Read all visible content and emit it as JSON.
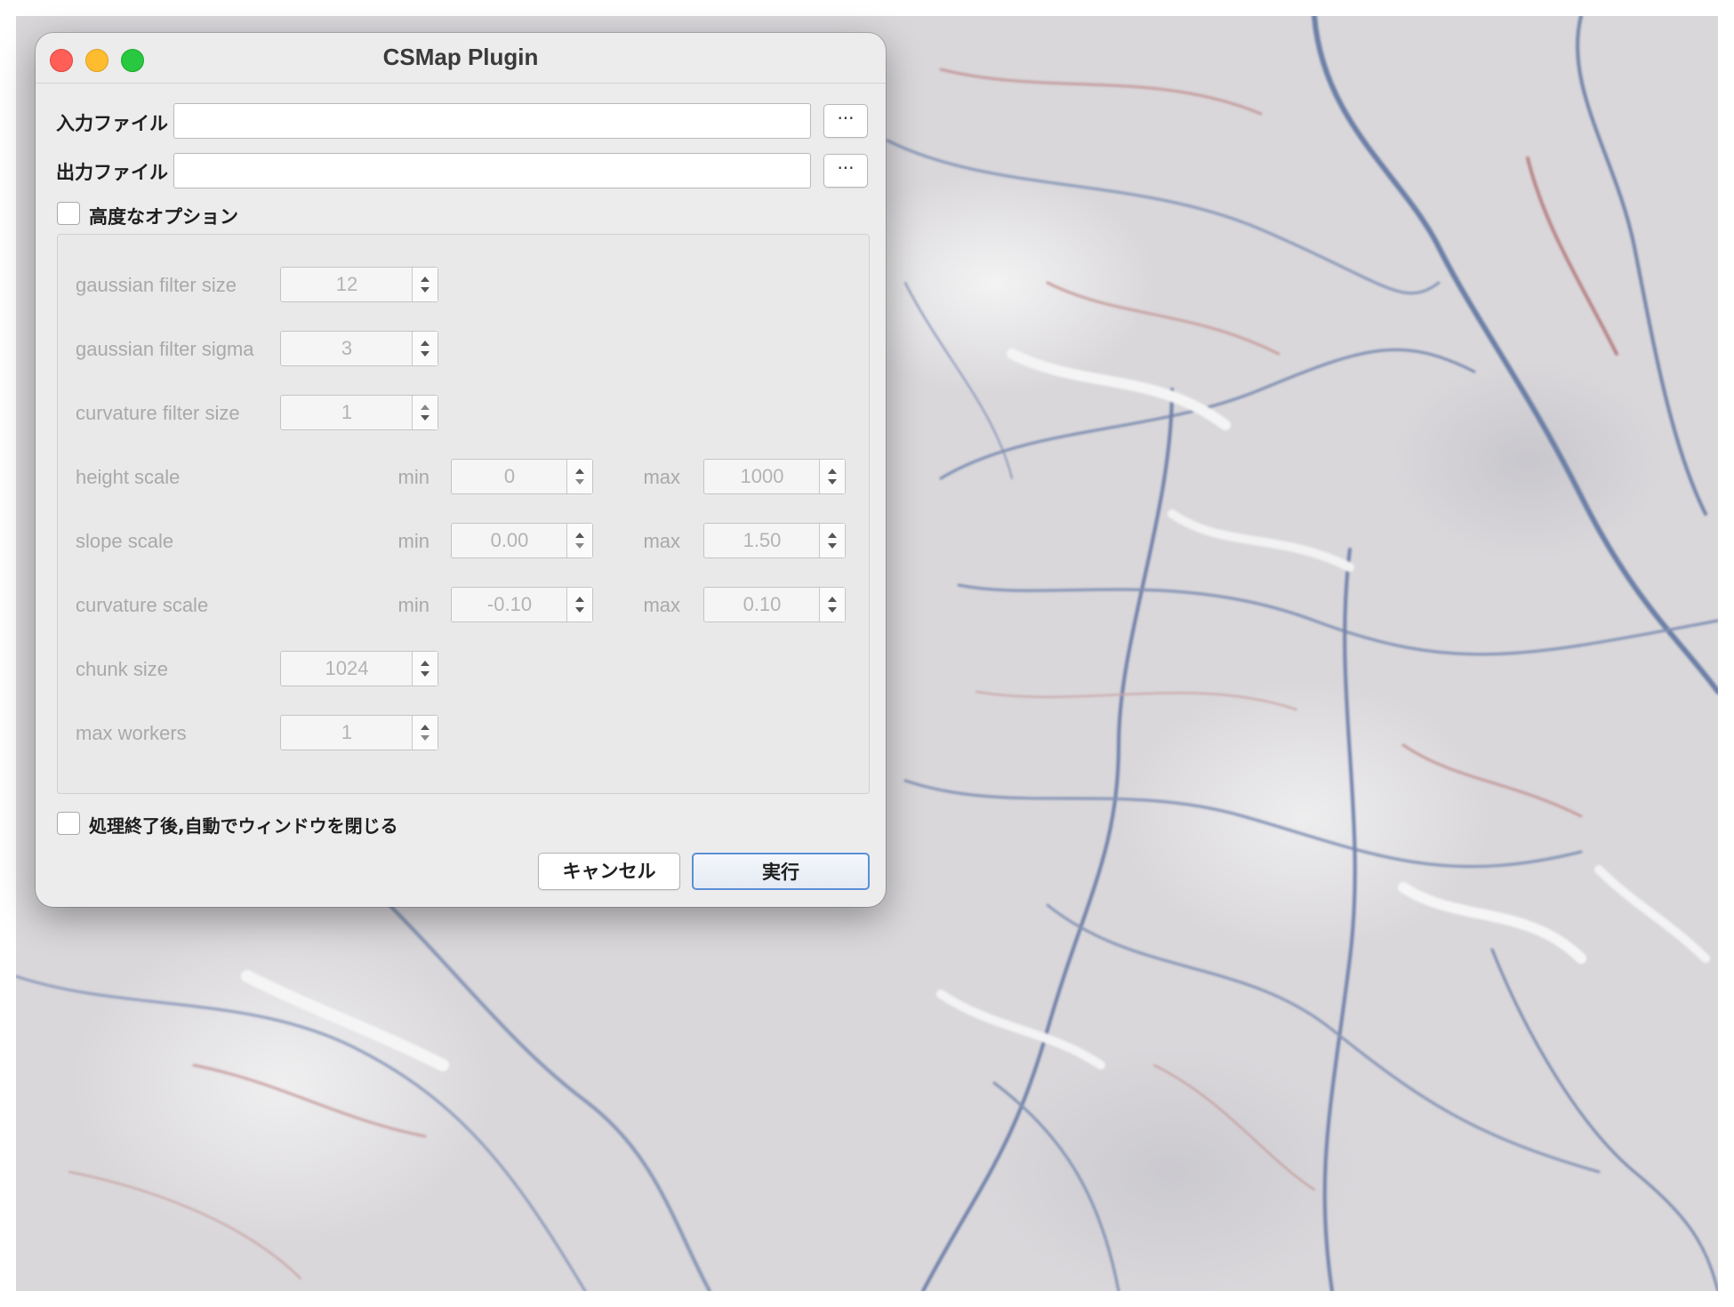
{
  "window": {
    "title": "CSMap Plugin"
  },
  "inputs": {
    "input_file_label": "入力ファイル",
    "input_file_value": "",
    "output_file_label": "出力ファイル",
    "output_file_value": "",
    "browse_label": "···"
  },
  "advanced": {
    "label": "高度なオプション",
    "checked": false,
    "params": {
      "gaussian_filter_size": {
        "label": "gaussian filter size",
        "value": "12"
      },
      "gaussian_filter_sigma": {
        "label": "gaussian filter sigma",
        "value": "3"
      },
      "curvature_filter_size": {
        "label": "curvature filter size",
        "value": "1"
      },
      "height_scale": {
        "label": "height scale",
        "min_label": "min",
        "min": "0",
        "max_label": "max",
        "max": "1000"
      },
      "slope_scale": {
        "label": "slope scale",
        "min_label": "min",
        "min": "0.00",
        "max_label": "max",
        "max": "1.50"
      },
      "curvature_scale": {
        "label": "curvature scale",
        "min_label": "min",
        "min": "-0.10",
        "max_label": "max",
        "max": "0.10"
      },
      "chunk_size": {
        "label": "chunk size",
        "value": "1024"
      },
      "max_workers": {
        "label": "max workers",
        "value": "1"
      }
    }
  },
  "auto_close": {
    "label": "処理終了後,自動でウィンドウを閉じる",
    "checked": false
  },
  "buttons": {
    "cancel": "キャンセル",
    "run": "実行"
  },
  "colors": {
    "close": "#ff5f57",
    "minimize": "#febc2e",
    "maximize": "#28c840",
    "default_button_border": "#5b8fd6"
  }
}
